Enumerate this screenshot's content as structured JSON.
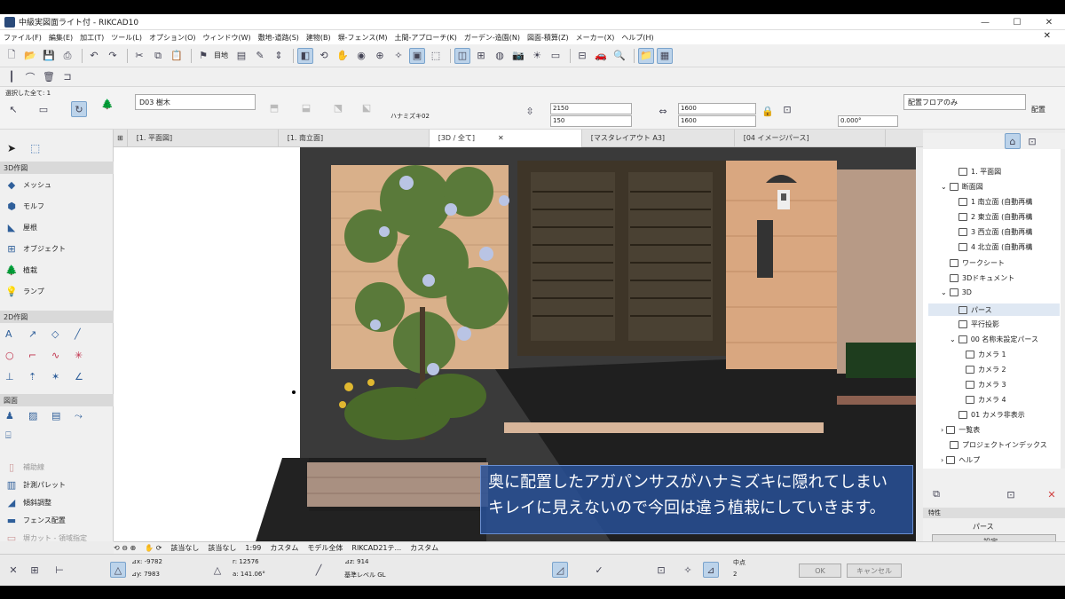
{
  "window": {
    "title": "中級実図面ライト付 - RIKCAD10",
    "min": "—",
    "max": "☐",
    "close": "✕"
  },
  "menu": [
    "ファイル(F)",
    "編集(E)",
    "加工(T)",
    "ツール(L)",
    "オプション(O)",
    "ウィンドウ(W)",
    "敷地-道路(S)",
    "建物(B)",
    "塀-フェンス(M)",
    "土間-アプローチ(K)",
    "ガーデン-造園(N)",
    "図面-積算(Z)",
    "メーカー(X)",
    "ヘルプ(H)"
  ],
  "toolbar": {
    "view_label": "目地",
    "selection_label": "選択した全て: 1"
  },
  "infobox": {
    "layer": "D03 樹木",
    "object_name": "ハナミズキ02",
    "height_top": "2150",
    "height_bottom": "150",
    "width_a": "1600",
    "width_b": "1600",
    "angle": "0.000°",
    "floor_placement": "配置フロアのみ",
    "placement_label": "配置"
  },
  "tabs": [
    {
      "label": "[1. 平面図]"
    },
    {
      "label": "[1. 南立面]"
    },
    {
      "label": "[3D / 全て]",
      "close": "✕"
    },
    {
      "label": "[マスタレイアウト A3]"
    },
    {
      "label": "[04 イメージパース]"
    }
  ],
  "left_panel": {
    "section_3d": "3D作図",
    "tools_3d": [
      "メッシュ",
      "モルフ",
      "屋根",
      "オブジェクト",
      "植栽",
      "ランプ"
    ],
    "section_2d": "2D作図",
    "section_drawing": "図面",
    "tools_bottom": [
      "補助線",
      "計測パレット",
      "傾斜調整",
      "フェンス配置",
      "塀カット - 領域指定",
      "塀カット - 上限"
    ]
  },
  "navigator": {
    "items": [
      {
        "label": "1. 平面図",
        "indent": 2
      },
      {
        "label": "断面図",
        "indent": 1,
        "arrow": "⌄"
      },
      {
        "label": "1 南立面 (自動再構",
        "indent": 2
      },
      {
        "label": "2 東立面 (自動再構",
        "indent": 2
      },
      {
        "label": "3 西立面 (自動再構",
        "indent": 2
      },
      {
        "label": "4 北立面 (自動再構",
        "indent": 2
      },
      {
        "label": "ワークシート",
        "indent": 1
      },
      {
        "label": "3Dドキュメント",
        "indent": 1
      },
      {
        "label": "3D",
        "indent": 1,
        "arrow": "⌄"
      },
      {
        "label": "パース",
        "indent": 2,
        "selected": true
      },
      {
        "label": "平行投影",
        "indent": 2
      },
      {
        "label": "00 名称未設定パース",
        "indent": 2,
        "arrow": "⌄"
      },
      {
        "label": "カメラ 1",
        "indent": 3
      },
      {
        "label": "カメラ 2",
        "indent": 3
      },
      {
        "label": "カメラ 3",
        "indent": 3
      },
      {
        "label": "カメラ 4",
        "indent": 3
      },
      {
        "label": "01 カメラ非表示",
        "indent": 2
      },
      {
        "label": "一覧表",
        "indent": 1,
        "arrow": "›"
      },
      {
        "label": "プロジェクトインデックス",
        "indent": 1
      },
      {
        "label": "ヘルプ",
        "indent": 1,
        "arrow": "›"
      }
    ],
    "props_header": "特性",
    "props_value": "パース",
    "settings_button": "設定..."
  },
  "statusbar": {
    "undo_label": "該当なし",
    "redo_label": "該当なし",
    "scale": "1:99",
    "custom1": "カスタム",
    "model": "モデル全体",
    "template": "RIKCAD21テ...",
    "custom2": "カスタム"
  },
  "coords": {
    "dx": "⊿x: -9782",
    "dy": "⊿y: 7983",
    "r": "r: 12576",
    "a": "a: 141.06°",
    "dz": "⊿z: 914",
    "ref": "基準レベル GL",
    "snap": "中点",
    "snap_n": "2",
    "ok": "OK",
    "cancel": "キャンセル"
  },
  "subtitle": {
    "line1": "奥に配置したアガパンサスがハナミズキに隠れてしまい",
    "line2": "キレイに見えないので今回は違う植栽にしていきます。"
  }
}
